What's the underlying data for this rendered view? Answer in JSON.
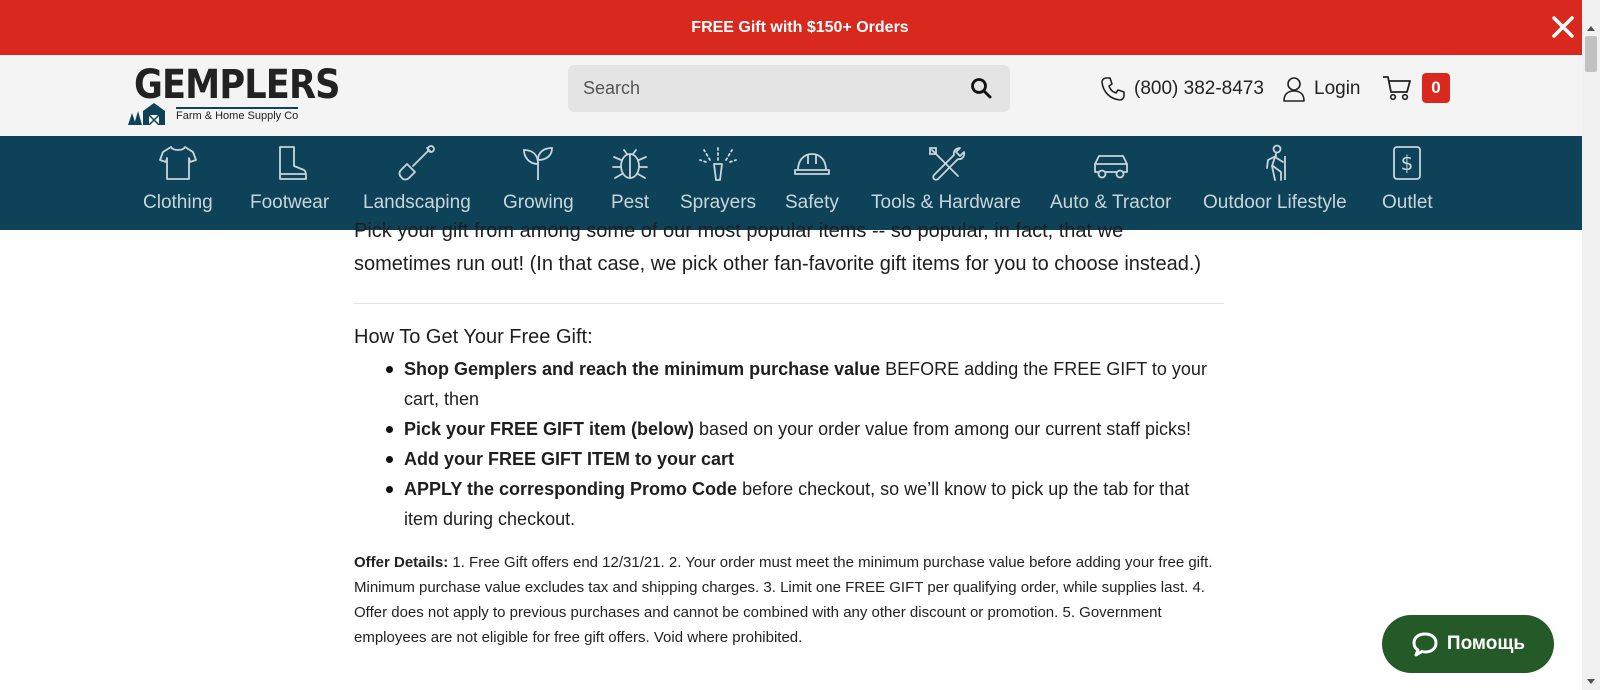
{
  "promo": {
    "text": "FREE Gift with $150+ Orders",
    "close_icon": "close-icon"
  },
  "header": {
    "logo": {
      "word": "GEMPLERS",
      "tagline": "Farm & Home Supply Co"
    },
    "search": {
      "placeholder": "Search",
      "value": ""
    },
    "phone": "(800) 382-8473",
    "login": "Login",
    "cart_count": "0"
  },
  "nav": {
    "items": [
      {
        "label": "Clothing",
        "icon": "shirt-icon"
      },
      {
        "label": "Footwear",
        "icon": "boot-icon"
      },
      {
        "label": "Landscaping",
        "icon": "shovel-icon"
      },
      {
        "label": "Growing",
        "icon": "sprout-icon"
      },
      {
        "label": "Pest",
        "icon": "bug-icon"
      },
      {
        "label": "Sprayers",
        "icon": "sprayer-icon"
      },
      {
        "label": "Safety",
        "icon": "hardhat-icon"
      },
      {
        "label": "Tools & Hardware",
        "icon": "tools-icon"
      },
      {
        "label": "Auto & Tractor",
        "icon": "car-icon"
      },
      {
        "label": "Outdoor Lifestyle",
        "icon": "hiker-icon"
      },
      {
        "label": "Outlet",
        "icon": "dollar-tag-icon"
      }
    ]
  },
  "content": {
    "intro": "Pick your gift from among some of our most popular items -- so popular, in fact, that we sometimes run out! (In that case, we pick other fan-favorite gift items for you to choose instead.)",
    "howto_title": "How To Get Your Free Gift:",
    "steps": [
      {
        "bold": "Shop Gemplers and reach the minimum purchase value",
        "rest": " BEFORE adding the FREE GIFT to your cart, then"
      },
      {
        "bold": "Pick your FREE GIFT item (below)",
        "rest": " based on your order value from among our current staff picks!"
      },
      {
        "bold": "Add your FREE GIFT ITEM to your cart",
        "rest": ""
      },
      {
        "bold": "APPLY the corresponding Promo Code",
        "rest": " before checkout, so we’ll know to pick up the tab for that item during checkout."
      }
    ],
    "offer_label": "Offer Details:",
    "offer_text": " 1. Free Gift offers end 12/31/21. 2. Your order must meet the minimum purchase value before adding your free gift. Minimum purchase value excludes tax and shipping charges. 3. Limit one FREE GIFT per qualifying order, while supplies last. 4. Offer does not apply to previous purchases and cannot be combined with any other discount or promotion. 5. Government employees are not eligible for free gift offers. Void where prohibited."
  },
  "help_widget": {
    "label": "Помощь",
    "icon": "chat-bubble-icon"
  },
  "colors": {
    "promo_red": "#d9291f",
    "nav_teal": "#0d4258",
    "help_green": "#245a27"
  }
}
